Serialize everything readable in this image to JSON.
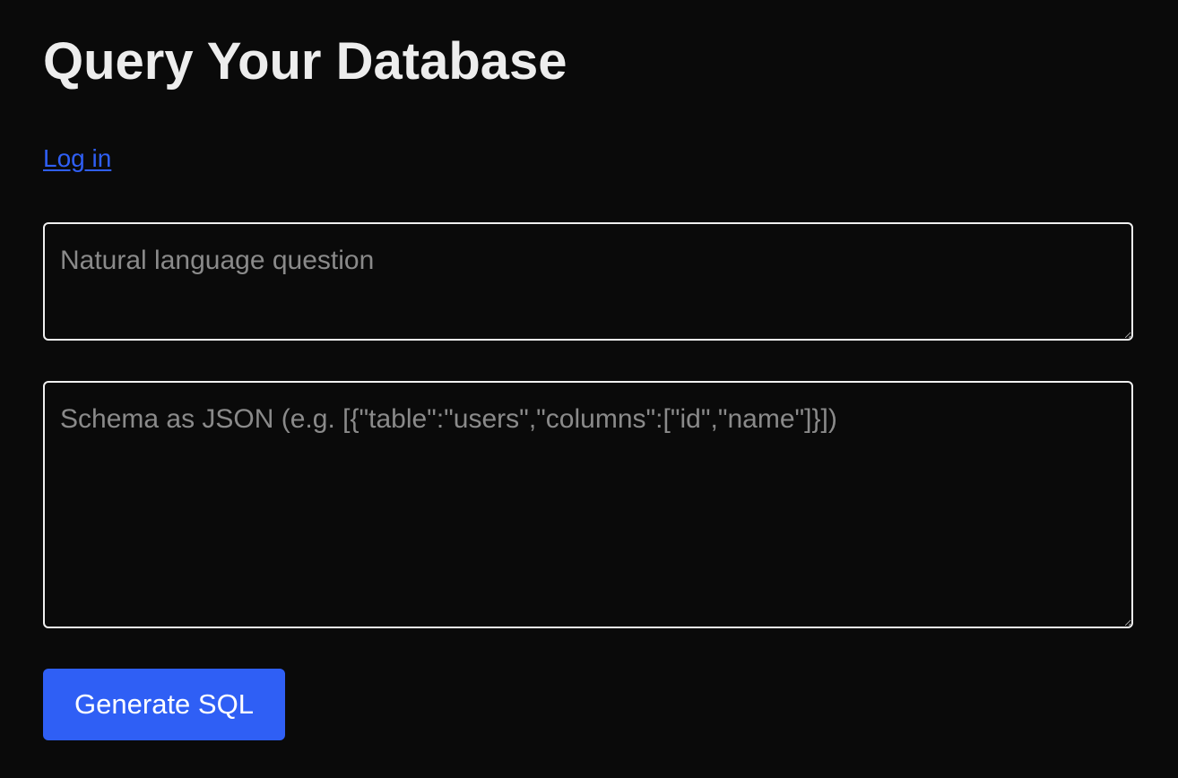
{
  "page": {
    "title": "Query Your Database",
    "login_label": "Log in"
  },
  "form": {
    "question": {
      "value": "",
      "placeholder": "Natural language question"
    },
    "schema": {
      "value": "",
      "placeholder": "Schema as JSON (e.g. [{\"table\":\"users\",\"columns\":[\"id\",\"name\"]}])"
    },
    "submit_label": "Generate SQL"
  },
  "colors": {
    "background": "#0a0a0a",
    "text": "#ededed",
    "accent": "#2f5ff5",
    "placeholder": "#8a8a8a",
    "field_border": "#f0f0f0"
  }
}
